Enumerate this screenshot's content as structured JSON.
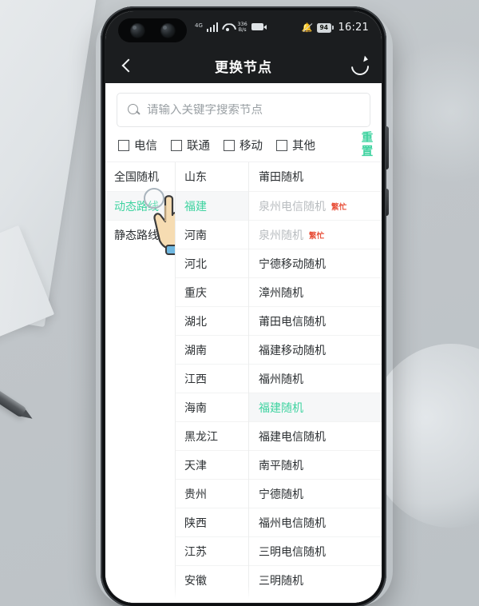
{
  "statusbar": {
    "network_type": "4G",
    "netspeed_value": "336",
    "netspeed_unit": "B/s",
    "battery_level": "94",
    "time": "16:21"
  },
  "header": {
    "title": "更换节点",
    "back_icon": "chevron-left-icon",
    "refresh_icon": "refresh-icon"
  },
  "search": {
    "icon": "search-icon",
    "placeholder": "请输入关键字搜索节点",
    "value": ""
  },
  "filters": {
    "options": [
      {
        "label": "电信",
        "checked": false
      },
      {
        "label": "联通",
        "checked": false
      },
      {
        "label": "移动",
        "checked": false
      },
      {
        "label": "其他",
        "checked": false
      }
    ],
    "reset_label": "重置",
    "reset_color": "#3fd3a0"
  },
  "columns": {
    "category": {
      "items": [
        {
          "label": "全国随机",
          "selected": false,
          "disabled": false
        },
        {
          "label": "动态路线",
          "selected": true,
          "disabled": false
        },
        {
          "label": "静态路线",
          "selected": false,
          "disabled": false
        }
      ]
    },
    "region": {
      "items": [
        {
          "label": "山东",
          "selected": false,
          "disabled": false
        },
        {
          "label": "福建",
          "selected": true,
          "disabled": false
        },
        {
          "label": "河南",
          "selected": false,
          "disabled": false
        },
        {
          "label": "河北",
          "selected": false,
          "disabled": false
        },
        {
          "label": "重庆",
          "selected": false,
          "disabled": false
        },
        {
          "label": "湖北",
          "selected": false,
          "disabled": false
        },
        {
          "label": "湖南",
          "selected": false,
          "disabled": false
        },
        {
          "label": "江西",
          "selected": false,
          "disabled": false
        },
        {
          "label": "海南",
          "selected": false,
          "disabled": false
        },
        {
          "label": "黑龙江",
          "selected": false,
          "disabled": false
        },
        {
          "label": "天津",
          "selected": false,
          "disabled": false
        },
        {
          "label": "贵州",
          "selected": false,
          "disabled": false
        },
        {
          "label": "陕西",
          "selected": false,
          "disabled": false
        },
        {
          "label": "江苏",
          "selected": false,
          "disabled": false
        },
        {
          "label": "安徽",
          "selected": false,
          "disabled": false
        }
      ]
    },
    "node": {
      "busy_badge": "繁忙",
      "items": [
        {
          "label": "莆田随机",
          "selected": false,
          "disabled": false,
          "busy": false
        },
        {
          "label": "泉州电信随机",
          "selected": false,
          "disabled": true,
          "busy": true
        },
        {
          "label": "泉州随机",
          "selected": false,
          "disabled": true,
          "busy": true
        },
        {
          "label": "宁德移动随机",
          "selected": false,
          "disabled": false,
          "busy": false
        },
        {
          "label": "漳州随机",
          "selected": false,
          "disabled": false,
          "busy": false
        },
        {
          "label": "莆田电信随机",
          "selected": false,
          "disabled": false,
          "busy": false
        },
        {
          "label": "福建移动随机",
          "selected": false,
          "disabled": false,
          "busy": false
        },
        {
          "label": "福州随机",
          "selected": false,
          "disabled": false,
          "busy": false
        },
        {
          "label": "福建随机",
          "selected": true,
          "disabled": false,
          "busy": false
        },
        {
          "label": "福建电信随机",
          "selected": false,
          "disabled": false,
          "busy": false
        },
        {
          "label": "南平随机",
          "selected": false,
          "disabled": false,
          "busy": false
        },
        {
          "label": "宁德随机",
          "selected": false,
          "disabled": false,
          "busy": false
        },
        {
          "label": "福州电信随机",
          "selected": false,
          "disabled": false,
          "busy": false
        },
        {
          "label": "三明电信随机",
          "selected": false,
          "disabled": false,
          "busy": false
        },
        {
          "label": "三明随机",
          "selected": false,
          "disabled": false,
          "busy": false
        }
      ]
    }
  },
  "cursor": {
    "icon": "hand-pointer-cursor"
  }
}
